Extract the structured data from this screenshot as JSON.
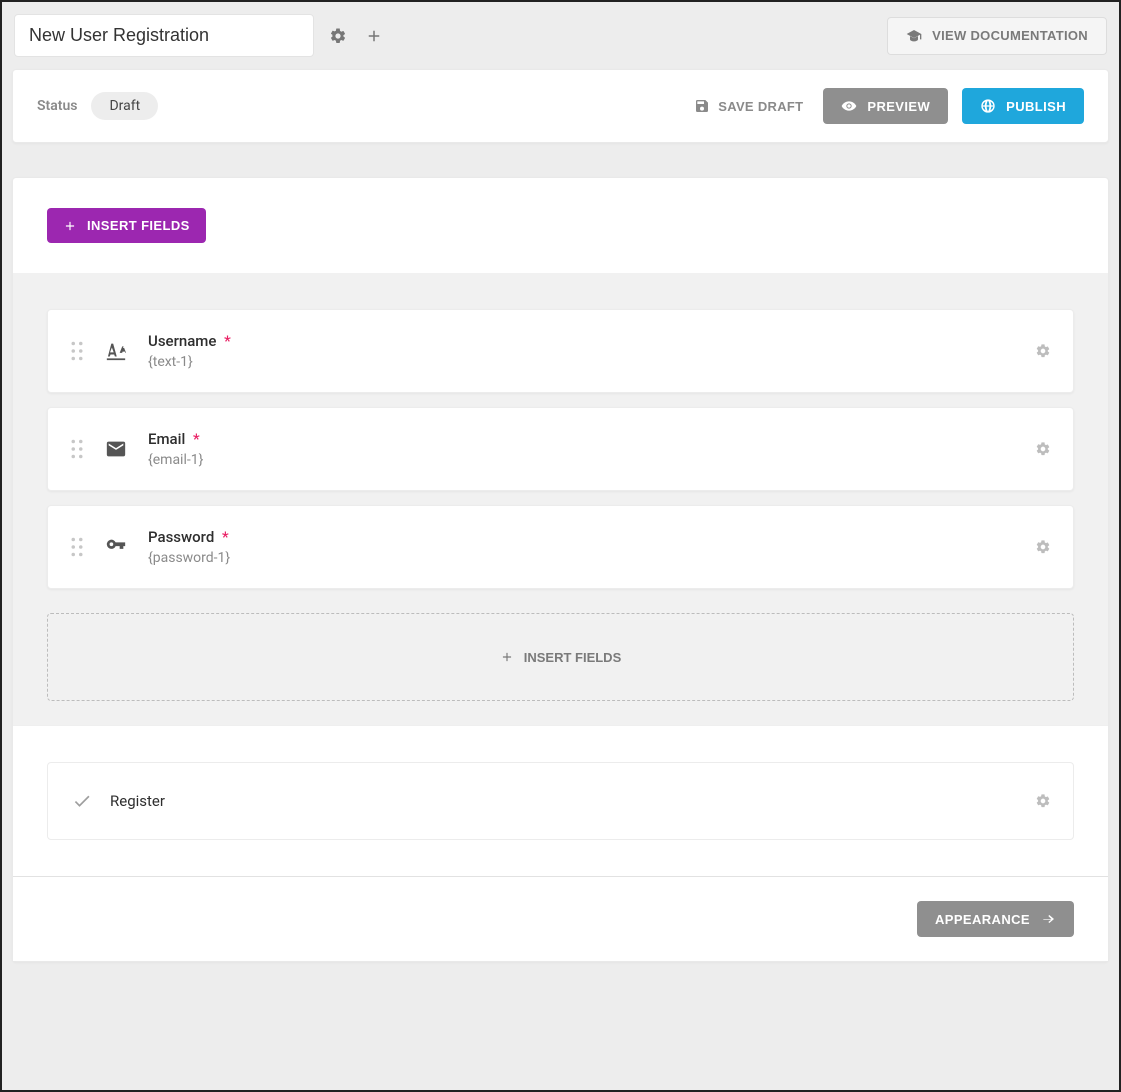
{
  "header": {
    "title": "New User Registration",
    "documentation_label": "VIEW DOCUMENTATION"
  },
  "status": {
    "label": "Status",
    "value": "Draft",
    "save_draft_label": "SAVE DRAFT",
    "preview_label": "PREVIEW",
    "publish_label": "PUBLISH"
  },
  "insert": {
    "top_label": "INSERT FIELDS",
    "drop_label": "INSERT FIELDS"
  },
  "fields": [
    {
      "icon": "text",
      "label": "Username",
      "required": true,
      "slug": "{text-1}"
    },
    {
      "icon": "email",
      "label": "Email",
      "required": true,
      "slug": "{email-1}"
    },
    {
      "icon": "password",
      "label": "Password",
      "required": true,
      "slug": "{password-1}"
    }
  ],
  "submit": {
    "label": "Register"
  },
  "footer": {
    "appearance_label": "APPEARANCE"
  }
}
